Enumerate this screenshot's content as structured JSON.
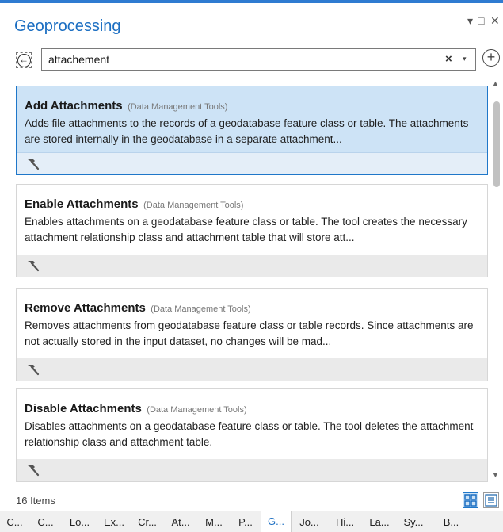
{
  "pane": {
    "title": "Geoprocessing",
    "controls": {
      "options": "▾",
      "maximize": "□",
      "close": "✕"
    }
  },
  "search": {
    "value": "attachement",
    "clear": "×",
    "dropdown": "▾",
    "back_icon": "back-arrow-circle-icon",
    "add_icon": "plus-circle-icon"
  },
  "results": [
    {
      "title": "Add Attachments",
      "category": "(Data Management Tools)",
      "description": "Adds file attachments to the records of a geodatabase feature class or table. The attachments are stored internally in the geodatabase in a separate attachment...",
      "selected": true
    },
    {
      "title": "Enable Attachments",
      "category": "(Data Management Tools)",
      "description": "Enables attachments on a geodatabase feature class or table. The tool creates the necessary attachment relationship class and attachment table that will store att...",
      "selected": false
    },
    {
      "title": "Remove Attachments",
      "category": "(Data Management Tools)",
      "description": "Removes attachments from geodatabase feature class or table records. Since attachments are not actually stored in the input dataset, no changes will be mad...",
      "selected": false
    },
    {
      "title": "Disable Attachments",
      "category": "(Data Management Tools)",
      "description": "Disables attachments on a geodatabase feature class or table. The tool deletes the attachment relationship class and attachment table.",
      "selected": false
    }
  ],
  "status": {
    "count": "16 Items"
  },
  "tabs": [
    {
      "label": "C...",
      "active": false
    },
    {
      "label": "C...",
      "active": false
    },
    {
      "label": "Lo...",
      "active": false
    },
    {
      "label": "Ex...",
      "active": false
    },
    {
      "label": "Cr...",
      "active": false
    },
    {
      "label": "At...",
      "active": false
    },
    {
      "label": "M...",
      "active": false
    },
    {
      "label": "P...",
      "active": false
    },
    {
      "label": "G...",
      "active": true
    },
    {
      "label": "Jo...",
      "active": false
    },
    {
      "label": "Hi...",
      "active": false
    },
    {
      "label": "La...",
      "active": false
    },
    {
      "label": "Sy...",
      "active": false
    },
    {
      "label": "B...",
      "active": false
    }
  ],
  "colors": {
    "accent": "#1b6ec2",
    "selected_bg": "#cde3f6",
    "selected_border": "#1f77c9"
  }
}
